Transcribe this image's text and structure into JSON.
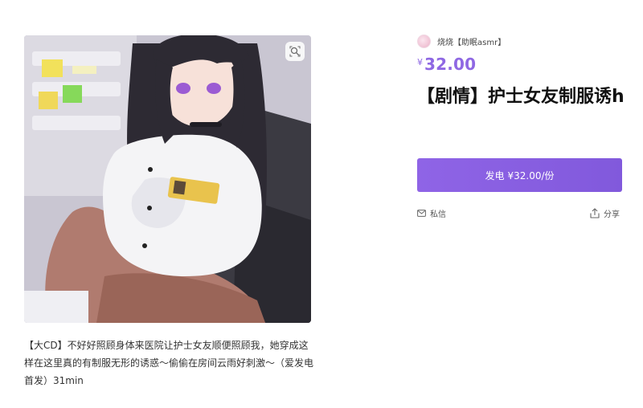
{
  "creator": {
    "name": "烧烧【助眠asmr】",
    "avatar_icon": "avatar"
  },
  "product": {
    "price_symbol": "¥",
    "price_value": "32.00",
    "title": "【剧情】护士女友制服诱h",
    "description": "【大CD】不好好照顾身体来医院让护士女友顺便照顾我，她穿成这样在这里真的有制服无形的诱惑～偷偷在房间云雨好刺激～（爱发电首发）31min"
  },
  "actions": {
    "sponsor_label": "发电",
    "sponsor_price": "¥32.00/份",
    "message_label": "私信",
    "share_label": "分享"
  },
  "icons": {
    "zoom": "zoom-icon",
    "message": "mail-icon",
    "share": "share-icon"
  },
  "colors": {
    "accent": "#8f68e3",
    "button_start": "#8f64e6",
    "button_end": "#8159dc"
  }
}
